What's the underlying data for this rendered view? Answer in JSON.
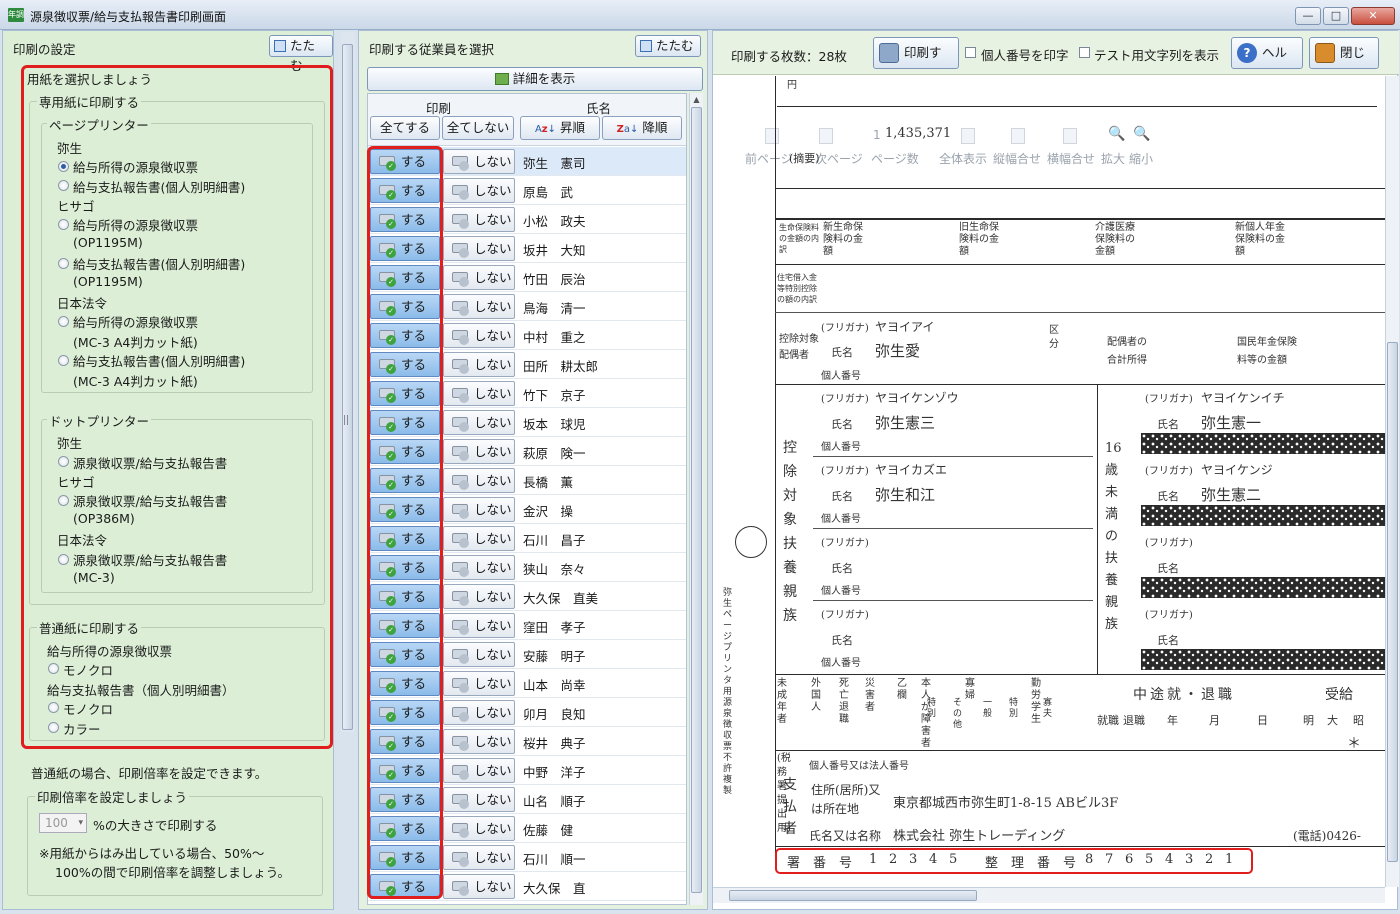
{
  "window": {
    "title": "源泉徴収票/給与支払報告書印刷画面",
    "app_icon": "年調",
    "min": "—",
    "max": "□",
    "close": "✕"
  },
  "left": {
    "title": "印刷の設定",
    "fold": "たたむ",
    "paper_heading": "用紙を選択しましょう",
    "special": "専用紙に印刷する",
    "page_printer": "ページプリンター",
    "yayoi": "弥生",
    "opt1": "給与所得の源泉徴収票",
    "opt2": "給与支払報告書(個人別明細書)",
    "hisago": "ヒサゴ",
    "opt3": "給与所得の源泉徴収票",
    "opt3_sub": "(OP1195M)",
    "opt4": "給与支払報告書(個人別明細書)",
    "opt4_sub": "(OP1195M)",
    "nihon": "日本法令",
    "opt5": "給与所得の源泉徴収票",
    "opt5_sub": "(MC-3 A4判カット紙)",
    "opt6": "給与支払報告書(個人別明細書)",
    "opt6_sub": "(MC-3 A4判カット紙)",
    "dot_printer": "ドットプリンター",
    "yayoi2": "弥生",
    "dopt1": "源泉徴収票/給与支払報告書",
    "hisago2": "ヒサゴ",
    "dopt2": "源泉徴収票/給与支払報告書",
    "dopt2_sub": "(OP386M)",
    "nihon2": "日本法令",
    "dopt3": "源泉徴収票/給与支払報告書",
    "dopt3_sub": "(MC-3)",
    "plain": "普通紙に印刷する",
    "plain_g1": "給与所得の源泉徴収票",
    "mono": "モノクロ",
    "plain_g2": "給与支払報告書（個人別明細書）",
    "mono2": "モノクロ",
    "color": "カラー",
    "scale_note": "普通紙の場合、印刷倍率を設定できます。",
    "scale_heading": "印刷倍率を設定しましょう",
    "scale_value": "100",
    "scale_suffix": "%の大きさで印刷する",
    "scale_help1": "※用紙からはみ出している場合、50%～",
    "scale_help2": "100%の間で印刷倍率を調整しましょう。"
  },
  "middle": {
    "title": "印刷する従業員を選択",
    "fold": "たたむ",
    "detail": "詳細を表示",
    "col_print": "印刷",
    "col_name": "氏名",
    "all_on": "全てする",
    "all_off": "全てしない",
    "asc": "昇順",
    "desc": "降順",
    "on": "する",
    "off": "しない",
    "employees": [
      "弥生　憲司",
      "原島　武",
      "小松　政夫",
      "坂井　大知",
      "竹田　辰治",
      "鳥海　清一",
      "中村　重之",
      "田所　耕太郎",
      "竹下　京子",
      "坂本　球児",
      "萩原　険一",
      "長橋　薫",
      "金沢　操",
      "石川　昌子",
      "狭山　奈々",
      "大久保　直美",
      "窪田　孝子",
      "安藤　明子",
      "山本　尚幸",
      "卯月　良知",
      "桜井　典子",
      "中野　洋子",
      "山名　順子",
      "佐藤　健",
      "石川　順一",
      "大久保　直"
    ]
  },
  "right": {
    "count": "印刷する枚数：28枚",
    "print": "印刷する",
    "chk_mynumber": "個人番号を印字",
    "chk_test": "テスト用文字列を表示",
    "help": "ヘルプ",
    "close": "閉じる",
    "overlay": [
      "前ページ",
      "次ページ",
      "1",
      "ページ数",
      "全体表示",
      "縦幅合せ",
      "横幅合せ",
      "拡大",
      "縮小"
    ],
    "form": {
      "amount_top": "1,435,371",
      "teki": "(摘要)",
      "yen": "円",
      "ins_life_label": "生命保険料の金額の内訳",
      "new_life": "新生命保険料の金額",
      "old_life": "旧生命保険料の金額",
      "care": "介護医療保険料の金額",
      "new_pension": "新個人年金保険料の金額",
      "housing_label": "住宅借入金等特別控除の額の内訳",
      "spouse_label": "控除対象配偶者",
      "furigana": "(フリガナ)",
      "name_lbl": "氏名",
      "mynum": "個人番号",
      "kubun": "区分",
      "spouse_kana": "ヤヨイアイ",
      "spouse_name": "弥生愛",
      "spouse_income": "配偶者の合計所得",
      "pension_amt": "国民年金保険料等の金額",
      "dep_label": "控除対象扶養親族",
      "dep1_kana": "ヤヨイケンゾウ",
      "dep1_name": "弥生憲三",
      "dep2_kana": "ヤヨイカズエ",
      "dep2_name": "弥生和江",
      "u16_label": "16歳未満の扶養親族",
      "u16_1_kana": "ヤヨイケンイチ",
      "u16_1_name": "弥生憲一",
      "u16_2_kana": "ヤヨイケンジ",
      "u16_2_name": "弥生憲二",
      "status": [
        "未成年者",
        "外国人",
        "死亡退職",
        "災害者",
        "乙欄",
        "本人が障害者",
        "寡婦",
        "勤労学生"
      ],
      "status_sub": [
        "特別",
        "その他",
        "一般",
        "特別",
        "寡夫"
      ],
      "midway": "中途就・退職",
      "jukyu": "受給",
      "midway_cols": [
        "就職",
        "退職",
        "年",
        "月",
        "日",
        "明",
        "大",
        "昭"
      ],
      "star": "＊",
      "payer": "支払者",
      "payer_id": "個人番号又は法人番号",
      "payer_addr_lbl": "住所(居所)又は所在地",
      "payer_addr": "東京都城西市弥生町1-8-15 ABビル3F",
      "payer_name_lbl": "氏名又は名称",
      "payer_name": "株式会社 弥生トレーディング",
      "payer_tel": "(電話)0426-",
      "submit": "(税務署提出用)",
      "vert_note": "弥生ページプリンタ用源泉徴収票　不許複製",
      "sho_label": "署　番　号",
      "sho_digits": [
        "1",
        "2",
        "3",
        "4",
        "5"
      ],
      "seiri_label": "整　理　番　号",
      "seiri_digits": [
        "8",
        "7",
        "6",
        "5",
        "4",
        "3",
        "2",
        "1"
      ]
    }
  }
}
